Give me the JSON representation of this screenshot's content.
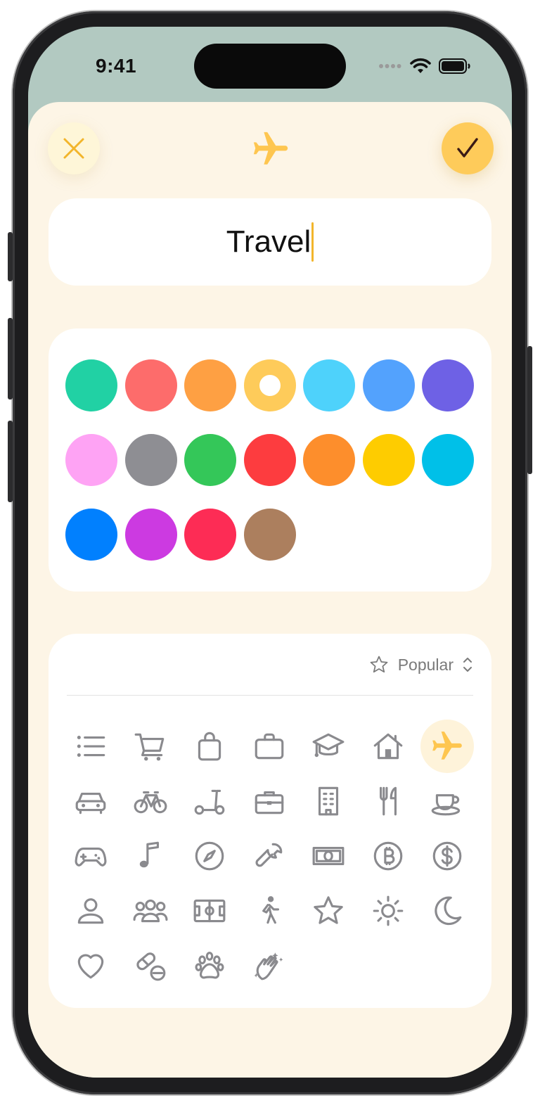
{
  "status_bar": {
    "time": "9:41"
  },
  "header": {
    "close_icon": "xmark-icon",
    "title_icon": "airplane-icon",
    "done_icon": "checkmark-icon",
    "accent_color": "#fecb5a"
  },
  "name_field": {
    "value": "Travel"
  },
  "colors": {
    "selected_index": 3,
    "swatches": [
      "#21d1a4",
      "#fd6c6b",
      "#fea043",
      "#fecb5a",
      "#4ed2fb",
      "#53a2fd",
      "#6e61e5",
      "#fea3f4",
      "#8e8e93",
      "#34c759",
      "#fd3c3f",
      "#fd8e2c",
      "#fecc00",
      "#00c0e8",
      "#0180fe",
      "#cc3ae1",
      "#fd2c55",
      "#ac7f5e"
    ]
  },
  "icons": {
    "category_label": "Popular",
    "category_icon": "star-icon",
    "selected_icon": "airplane-icon",
    "items": [
      "list-icon",
      "cart-icon",
      "bag-icon",
      "briefcase-icon",
      "graduation-cap-icon",
      "house-icon",
      "airplane-icon",
      "car-icon",
      "bicycle-icon",
      "scooter-icon",
      "toolbox-icon",
      "building-icon",
      "fork-knife-icon",
      "cup-saucer-icon",
      "gamecontroller-icon",
      "music-note-icon",
      "compass-icon",
      "wrench-icon",
      "banknote-icon",
      "bitcoin-icon",
      "dollar-icon",
      "person-icon",
      "people-icon",
      "soccer-field-icon",
      "walking-person-icon",
      "star-icon",
      "sun-icon",
      "moon-icon",
      "heart-icon",
      "pills-icon",
      "paw-icon",
      "clapping-hands-icon"
    ]
  }
}
